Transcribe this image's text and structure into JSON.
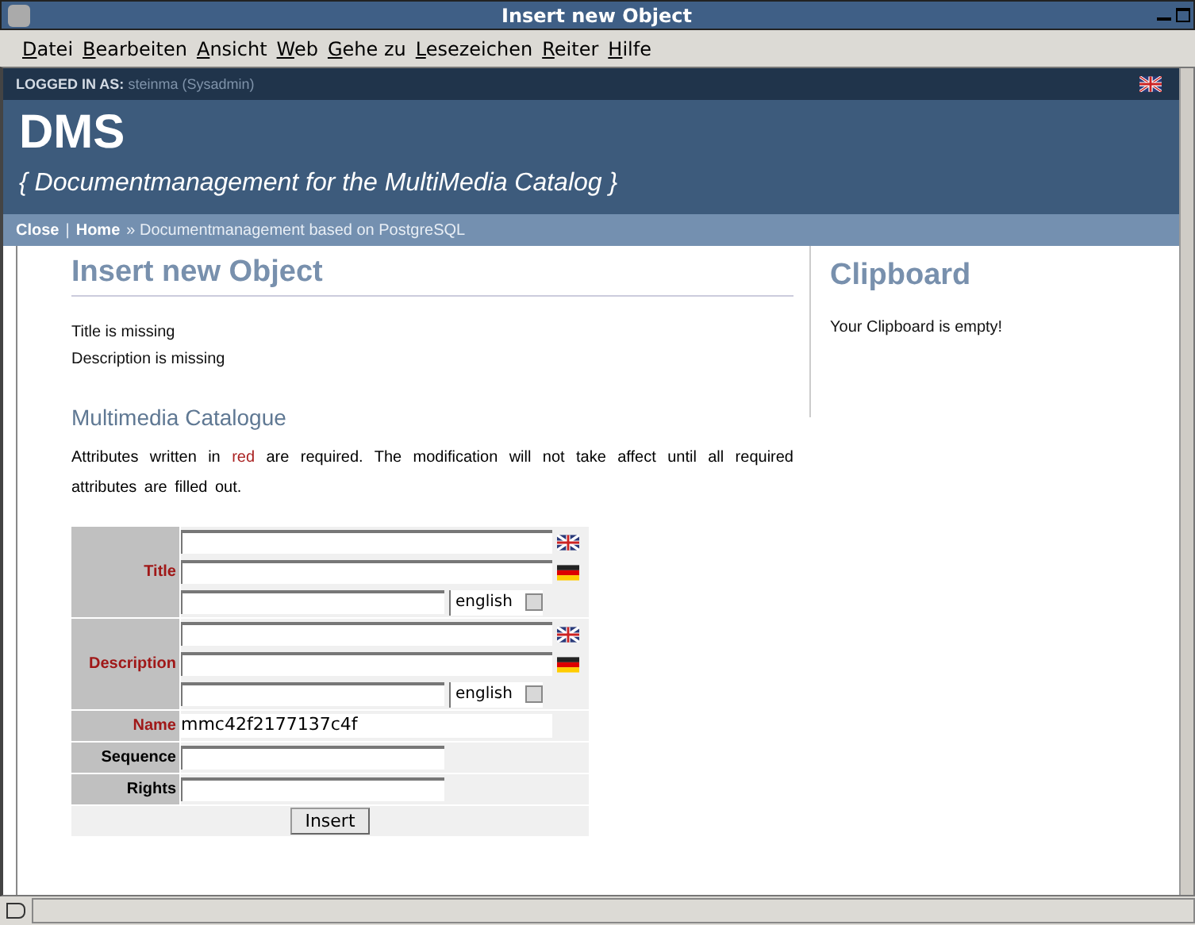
{
  "window": {
    "title": "Insert new Object"
  },
  "menu": [
    "Datei",
    "Bearbeiten",
    "Ansicht",
    "Web",
    "Gehe zu",
    "Lesezeichen",
    "Reiter",
    "Hilfe"
  ],
  "page": {
    "logged_in_label": "LOGGED IN AS:",
    "logged_in_user": "steinma (Sysadmin)",
    "site_title": "DMS",
    "site_subtitle": "{ Documentmanagement for the MultiMedia Catalog }",
    "breadcrumb": {
      "links": [
        "Close",
        "Home"
      ],
      "separator": "|",
      "arrow": "»",
      "text": "Documentmanagement based on PostgreSQL"
    }
  },
  "main": {
    "heading": "Insert new Object",
    "messages": [
      "Title is missing",
      "Description is missing"
    ],
    "section_heading": "Multimedia Catalogue",
    "note": {
      "before": "Attributes written in",
      "highlight": "red",
      "after": "are required. The modification will not take affect until all required attributes are filled out."
    }
  },
  "form": {
    "rows": [
      {
        "kind": "multilang",
        "label": "Title",
        "required": true,
        "select": "english"
      },
      {
        "kind": "multilang",
        "label": "Description",
        "required": true,
        "select": "english"
      },
      {
        "kind": "wide",
        "label": "Name",
        "required": true,
        "value": "mmc42f2177137c4f"
      },
      {
        "kind": "short",
        "label": "Sequence",
        "required": false
      },
      {
        "kind": "short",
        "label": "Rights",
        "required": false
      }
    ],
    "submit": "Insert"
  },
  "sidebar": {
    "heading": "Clipboard",
    "text": "Your Clipboard is empty!"
  }
}
